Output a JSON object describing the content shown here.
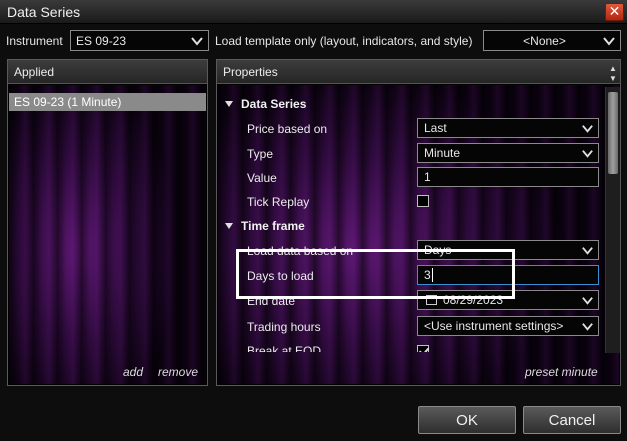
{
  "window": {
    "title": "Data Series",
    "close_glyph": "✕"
  },
  "instrument": {
    "label": "Instrument",
    "value": "ES 09-23"
  },
  "template": {
    "label": "Load template only (layout, indicators, and style)",
    "value": "<None>"
  },
  "applied": {
    "header": "Applied",
    "items": [
      "ES 09-23 (1 Minute)"
    ],
    "add_label": "add",
    "remove_label": "remove"
  },
  "properties": {
    "header": "Properties",
    "categories": {
      "data_series": "Data Series",
      "time_frame": "Time frame"
    },
    "rows": {
      "price_based_on": {
        "label": "Price based on",
        "value": "Last"
      },
      "type": {
        "label": "Type",
        "value": "Minute"
      },
      "value": {
        "label": "Value",
        "value": "1"
      },
      "tick_replay": {
        "label": "Tick Replay",
        "checked": false
      },
      "load_data_based_on": {
        "label": "Load data based on",
        "value": "Days"
      },
      "days_to_load": {
        "label": "Days to load",
        "value": "3"
      },
      "end_date": {
        "label": "End date",
        "value": "08/29/2023"
      },
      "trading_hours": {
        "label": "Trading hours",
        "value": "<Use instrument settings>"
      },
      "break_at_eod": {
        "label": "Break at EOD",
        "checked": true
      }
    },
    "preset_label": "preset minute"
  },
  "buttons": {
    "ok": "OK",
    "cancel": "Cancel"
  }
}
